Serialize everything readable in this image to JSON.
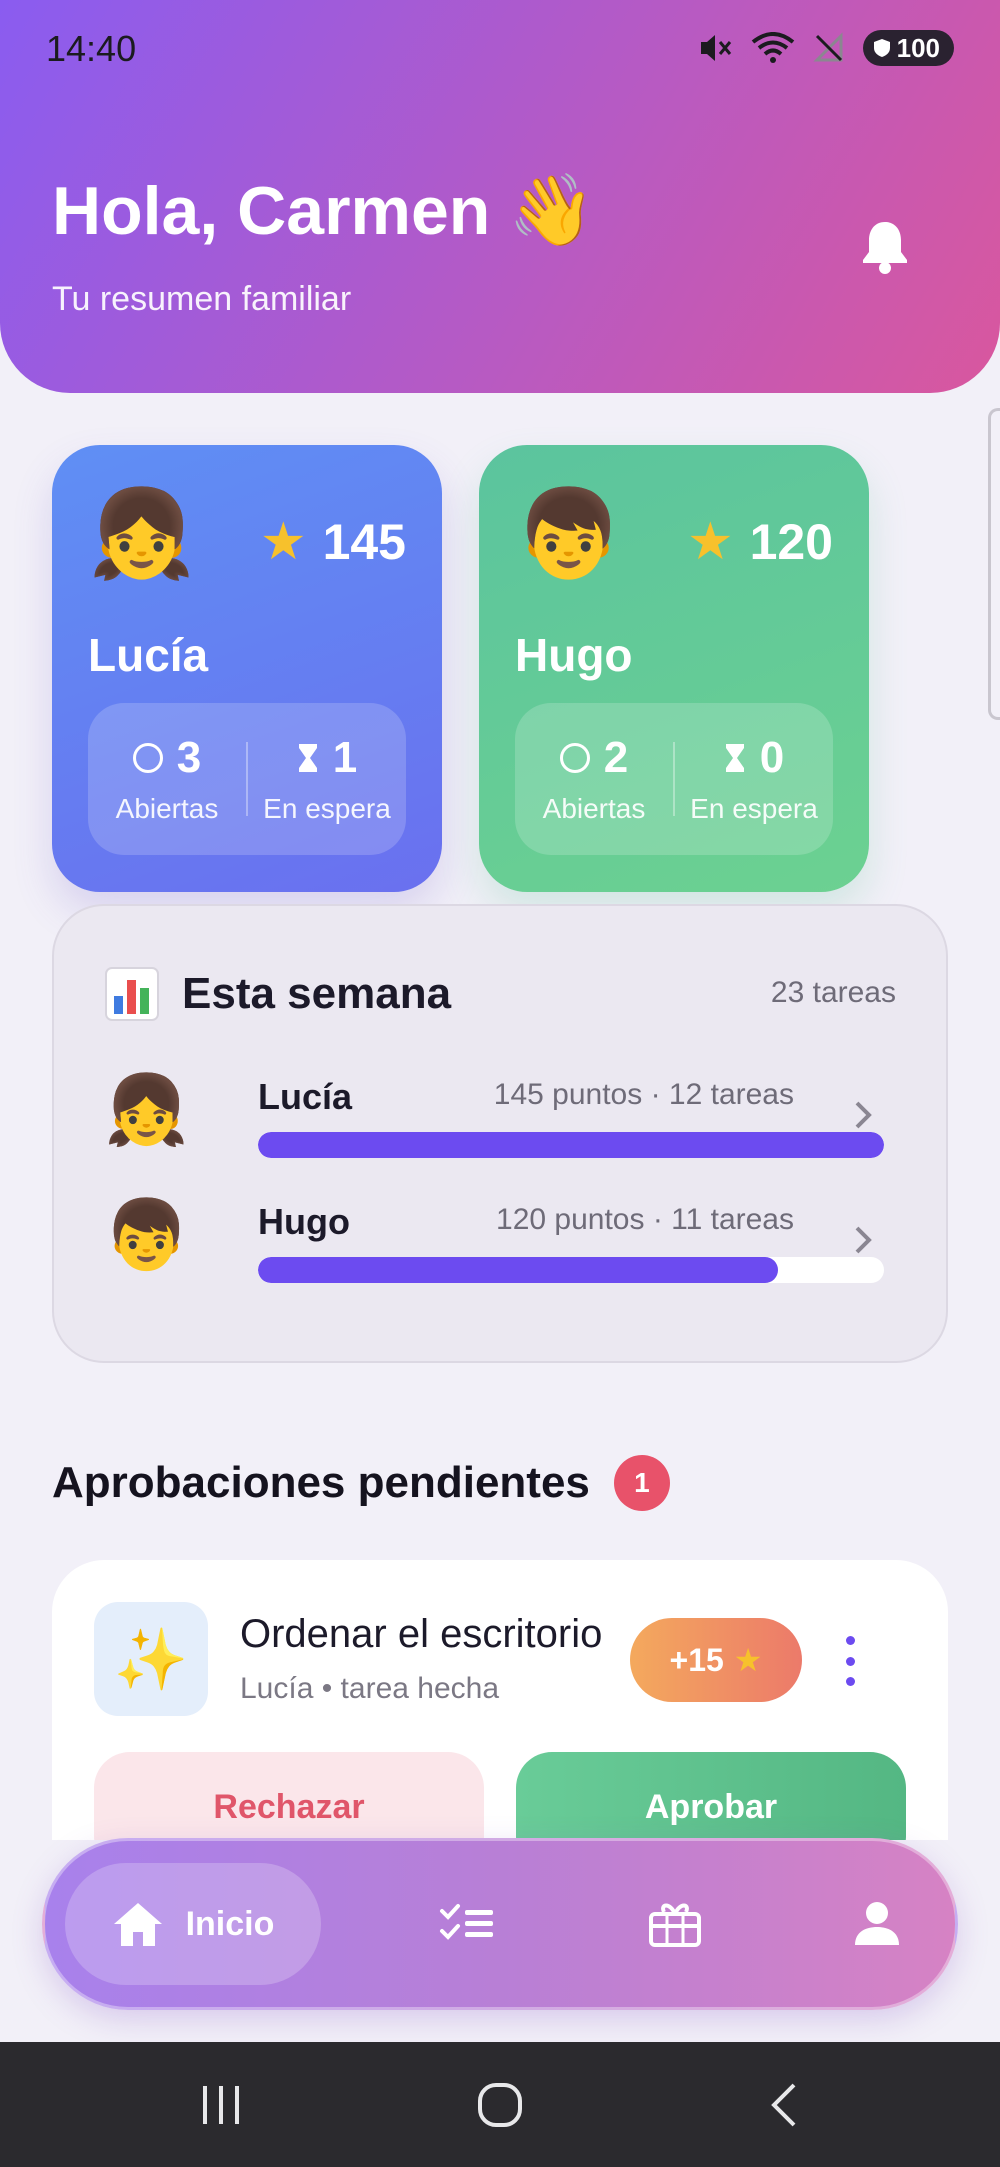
{
  "status_bar": {
    "time": "14:40",
    "battery": "100"
  },
  "header": {
    "greeting": "Hola, Carmen",
    "wave_emoji": "👋",
    "subtitle": "Tu resumen familiar",
    "bell_icon": "bell-icon"
  },
  "kids": [
    {
      "name": "Lucía",
      "avatar": "👧",
      "points": "145",
      "open_count": "3",
      "open_label": "Abiertas",
      "waiting_count": "1",
      "waiting_label": "En espera",
      "color": "#6480f2"
    },
    {
      "name": "Hugo",
      "avatar": "👦",
      "points": "120",
      "open_count": "2",
      "open_label": "Abiertas",
      "waiting_count": "0",
      "waiting_label": "En espera",
      "color": "#5fc99a"
    }
  ],
  "week": {
    "title": "Esta semana",
    "total": "23 tareas",
    "rows": [
      {
        "name": "Lucía",
        "avatar": "👧",
        "meta": "145 puntos · 12 tareas",
        "progress": 1.0
      },
      {
        "name": "Hugo",
        "avatar": "👦",
        "meta": "120 puntos · 11 tareas",
        "progress": 0.83
      }
    ]
  },
  "approvals": {
    "title": "Aprobaciones pendientes",
    "count": "1",
    "items": [
      {
        "icon": "✨",
        "title": "Ordenar el escritorio",
        "subtitle": "Lucía • tarea hecha",
        "reward": "+15",
        "reject_label": "Rechazar",
        "approve_label": "Aprobar"
      }
    ]
  },
  "nav": {
    "home_label": "Inicio",
    "items": [
      "home-icon",
      "tasks-icon",
      "rewards-icon",
      "profile-icon"
    ]
  },
  "colors": {
    "accent": "#6c4bf0",
    "reject": "#e0566a",
    "approve": "#5bbf8a",
    "badge": "#e8526a"
  }
}
